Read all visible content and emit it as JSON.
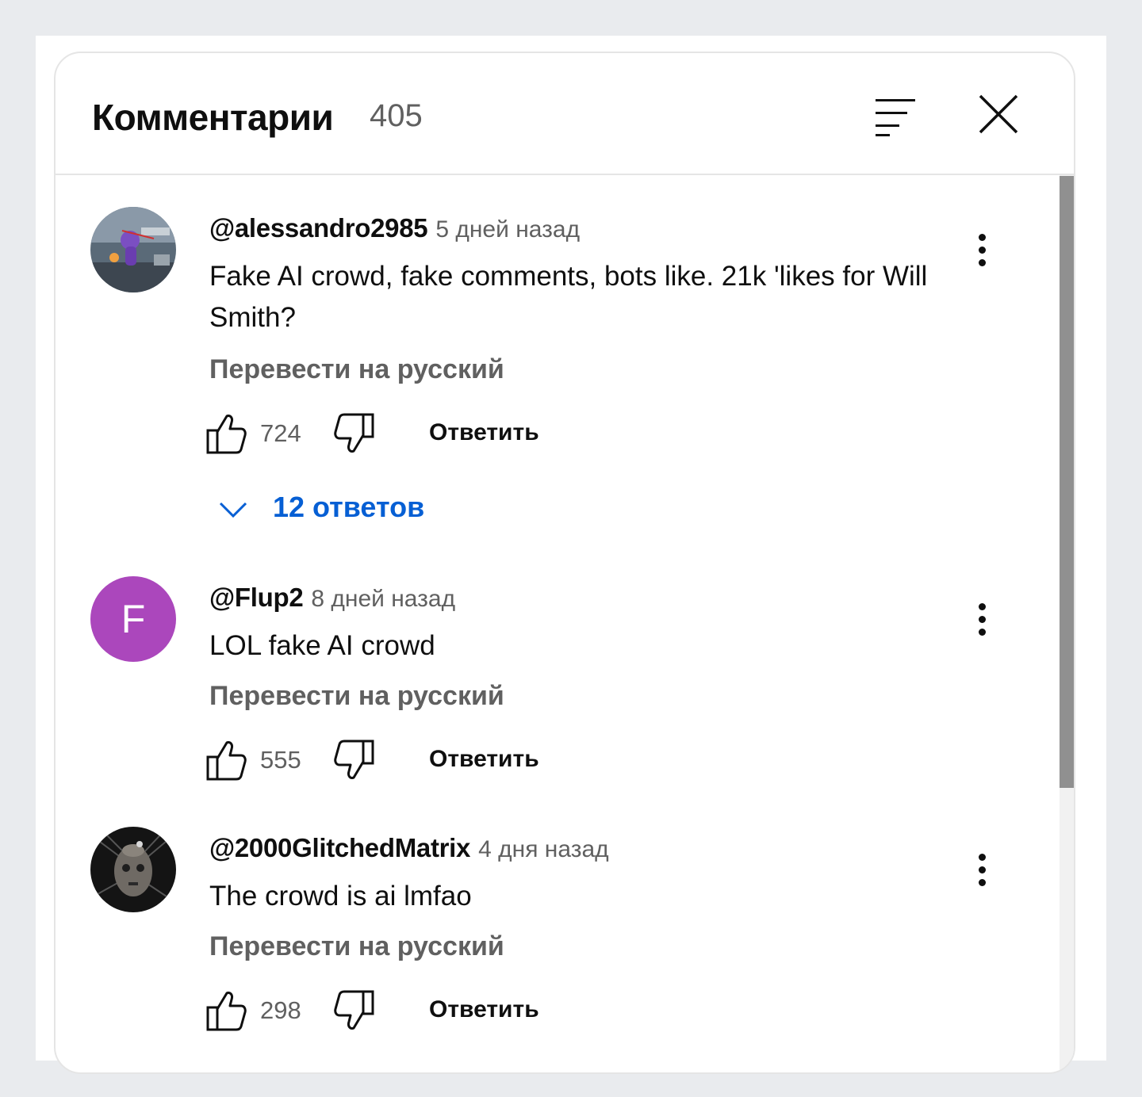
{
  "header": {
    "title": "Комментарии",
    "count": "405"
  },
  "comments": [
    {
      "author": "@alessandro2985",
      "time": "5 дней назад",
      "text": "Fake AI crowd, fake comments, bots like. 21k 'likes for Will Smith?",
      "translate": "Перевести на русский",
      "likes": "724",
      "reply": "Ответить",
      "replies": "12 ответов"
    },
    {
      "author": "@Flup2",
      "time": "8 дней назад",
      "avatar_letter": "F",
      "avatar_color": "#ab47bc",
      "text": "LOL fake AI crowd",
      "translate": "Перевести на русский",
      "likes": "555",
      "reply": "Ответить"
    },
    {
      "author": "@2000GlitchedMatrix",
      "time": "4 дня назад",
      "text": "The crowd is ai lmfao",
      "translate": "Перевести на русский",
      "likes": "298",
      "reply": "Ответить"
    }
  ],
  "icons": {
    "sort": "sort-icon",
    "close": "close-icon",
    "like": "thumbs-up-icon",
    "dislike": "thumbs-down-icon",
    "more": "more-vert-icon",
    "expand": "chevron-down-icon"
  },
  "colors": {
    "link": "#065fd4",
    "secondary_text": "#606060"
  }
}
